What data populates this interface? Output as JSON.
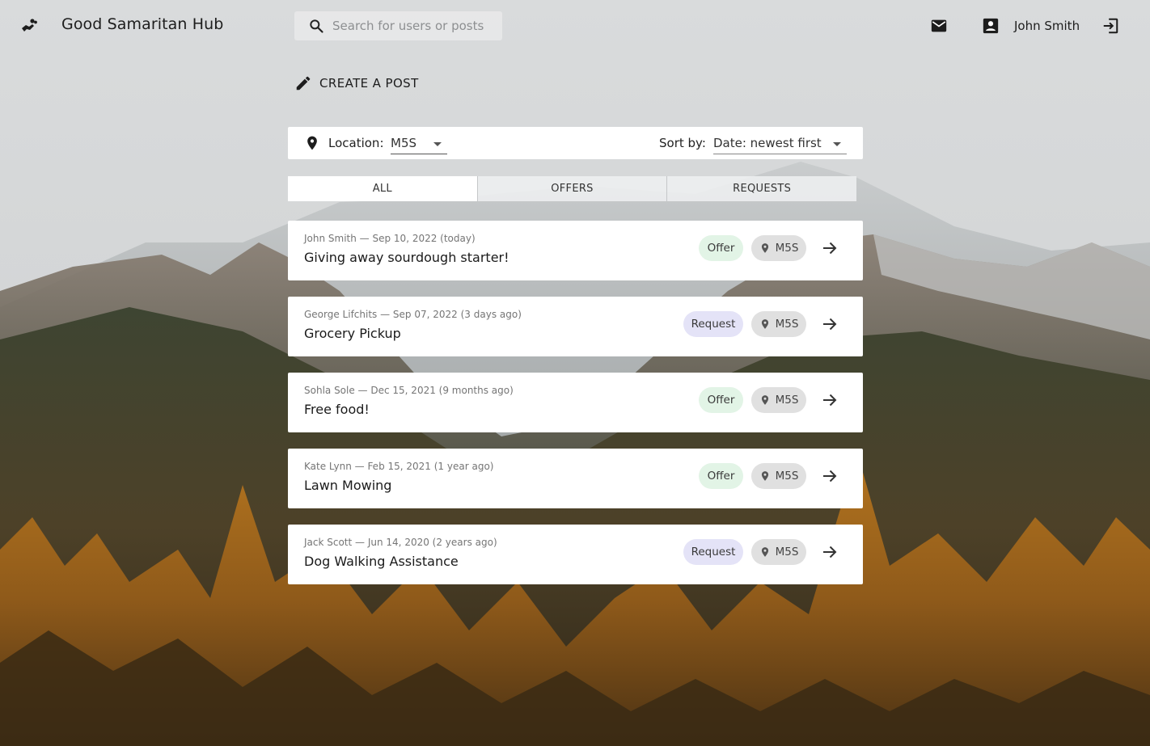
{
  "header": {
    "app_title": "Good Samaritan Hub",
    "search_placeholder": "Search for users or posts",
    "user_name": "John Smith"
  },
  "actions": {
    "create_post": "CREATE A POST"
  },
  "filters": {
    "location_label": "Location:",
    "location_value": "M5S",
    "sort_label": "Sort by:",
    "sort_value": "Date: newest first"
  },
  "tabs": [
    {
      "label": "ALL",
      "active": true
    },
    {
      "label": "OFFERS",
      "active": false
    },
    {
      "label": "REQUESTS",
      "active": false
    }
  ],
  "posts": [
    {
      "meta": "John Smith — Sep 10, 2022 (today)",
      "title": "Giving away sourdough starter!",
      "type": "Offer",
      "location": "M5S"
    },
    {
      "meta": "George Lifchits — Sep 07, 2022 (3 days ago)",
      "title": "Grocery Pickup",
      "type": "Request",
      "location": "M5S"
    },
    {
      "meta": "Sohla Sole — Dec 15, 2021 (9 months ago)",
      "title": "Free food!",
      "type": "Offer",
      "location": "M5S"
    },
    {
      "meta": "Kate Lynn — Feb 15, 2021 (1 year ago)",
      "title": "Lawn Mowing",
      "type": "Offer",
      "location": "M5S"
    },
    {
      "meta": "Jack Scott — Jun 14, 2020 (2 years ago)",
      "title": "Dog Walking Assistance",
      "type": "Request",
      "location": "M5S"
    }
  ],
  "icons": {
    "logo": "hands-heart-icon",
    "search": "search-icon",
    "mail": "mail-icon",
    "account": "account-box-icon",
    "logout": "logout-icon",
    "create": "pencil-icon",
    "location": "map-pin-icon",
    "open_post": "arrow-right-icon"
  },
  "colors": {
    "offer_chip": "#e2f4e6",
    "request_chip": "#e4e3f7",
    "location_chip": "#e0e0e0"
  }
}
